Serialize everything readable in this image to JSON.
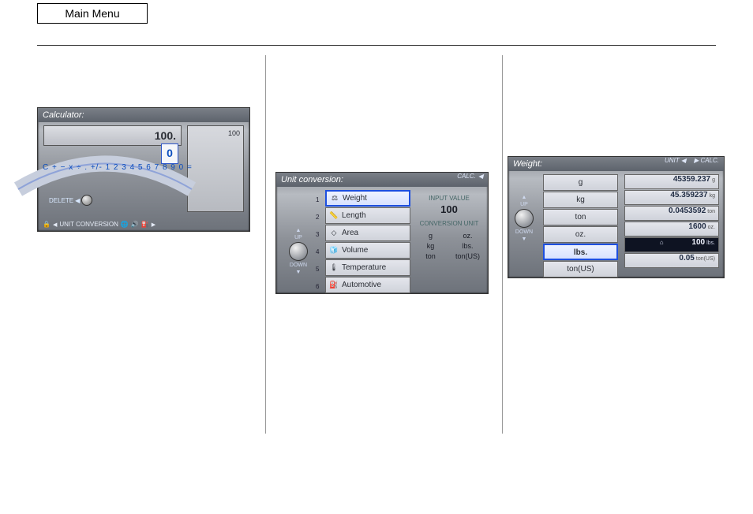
{
  "main_menu_label": "Main Menu",
  "calculator": {
    "title": "Calculator:",
    "display": "100.",
    "history_value": "100",
    "highlighted_key": "0",
    "keys_string": "C + − x ÷ . +/- 1 2 3 4 5 6 7 8 9 0 =",
    "delete_label": "DELETE",
    "footer_label": "UNIT CONVERSION"
  },
  "unit_conversion": {
    "title": "Unit conversion:",
    "calc_btn": "CALC.",
    "up_label": "UP",
    "down_label": "DOWN",
    "items": [
      {
        "n": "1",
        "icon": "⚖",
        "label": "Weight",
        "selected": true
      },
      {
        "n": "2",
        "icon": "📏",
        "label": "Length",
        "selected": false
      },
      {
        "n": "3",
        "icon": "◇",
        "label": "Area",
        "selected": false
      },
      {
        "n": "4",
        "icon": "🧊",
        "label": "Volume",
        "selected": false
      },
      {
        "n": "5",
        "icon": "🌡",
        "label": "Temperature",
        "selected": false
      },
      {
        "n": "6",
        "icon": "⛽",
        "label": "Automotive",
        "selected": false
      }
    ],
    "input_label": "INPUT VALUE",
    "input_value": "100",
    "conv_label": "CONVERSION UNIT",
    "conv_units_left": [
      "g",
      "kg",
      "ton"
    ],
    "conv_units_right": [
      "oz.",
      "lbs.",
      "ton(US)"
    ]
  },
  "weight": {
    "title": "Weight:",
    "unit_btn": "UNIT",
    "calc_btn": "CALC.",
    "up_label": "UP",
    "down_label": "DOWN",
    "units": [
      {
        "label": "g",
        "selected": false
      },
      {
        "label": "kg",
        "selected": false
      },
      {
        "label": "ton",
        "selected": false
      },
      {
        "label": "oz.",
        "selected": false
      },
      {
        "label": "lbs.",
        "selected": true
      },
      {
        "label": "ton(US)",
        "selected": false
      }
    ],
    "results": [
      {
        "value": "45359.237",
        "unit": "g",
        "active": false
      },
      {
        "value": "45.359237",
        "unit": "kg",
        "active": false
      },
      {
        "value": "0.0453592",
        "unit": "ton",
        "active": false
      },
      {
        "value": "1600",
        "unit": "oz.",
        "active": false
      },
      {
        "value": "100",
        "unit": "lbs.",
        "active": true
      },
      {
        "value": "0.05",
        "unit": "ton(US)",
        "active": false
      }
    ]
  }
}
